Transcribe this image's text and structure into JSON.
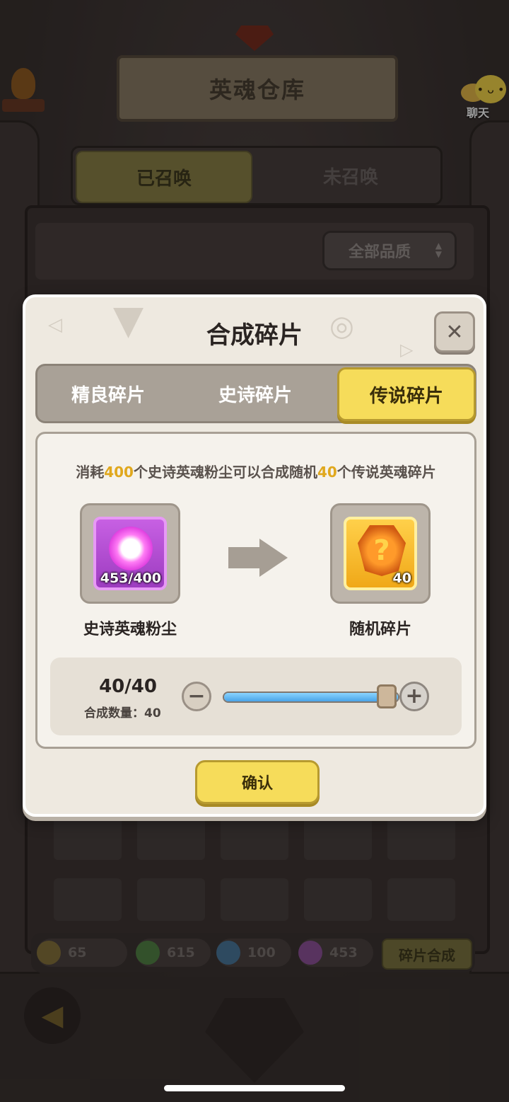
{
  "background": {
    "title": "英魂仓库",
    "chat_label": "聊天",
    "tabs": [
      {
        "label": "已召唤",
        "active": true
      },
      {
        "label": "未召唤",
        "active": false
      }
    ],
    "quality_filter": "全部品质",
    "resources": [
      {
        "icon": "flame-bowl-icon",
        "value": "65"
      },
      {
        "icon": "green-dust-icon",
        "value": "615"
      },
      {
        "icon": "blue-dust-icon",
        "value": "100"
      },
      {
        "icon": "purple-dust-icon",
        "value": "453"
      }
    ],
    "merge_button": "碎片合成"
  },
  "modal": {
    "title": "合成碎片",
    "tabs": [
      {
        "label": "精良碎片",
        "active": false
      },
      {
        "label": "史诗碎片",
        "active": false
      },
      {
        "label": "传说碎片",
        "active": true
      }
    ],
    "description": {
      "prefix": "消耗",
      "cost": "400",
      "middle": "个史诗英魂粉尘可以合成随机",
      "yield": "40",
      "suffix": "个传说英魂碎片"
    },
    "input_item": {
      "label": "史诗英魂粉尘",
      "count": "453/400",
      "icon": "epic-soul-dust-icon"
    },
    "output_item": {
      "label": "随机碎片",
      "count": "40",
      "icon": "random-legendary-fragment-icon"
    },
    "slider": {
      "amount": "40/40",
      "label": "合成数量：40",
      "fraction": 1.0
    },
    "confirm_label": "确认"
  },
  "colors": {
    "accent_yellow": "#f6dc5a",
    "highlight_number": "#e0a81e",
    "epic_purple": "#c760e3",
    "legend_gold": "#f0a818"
  }
}
